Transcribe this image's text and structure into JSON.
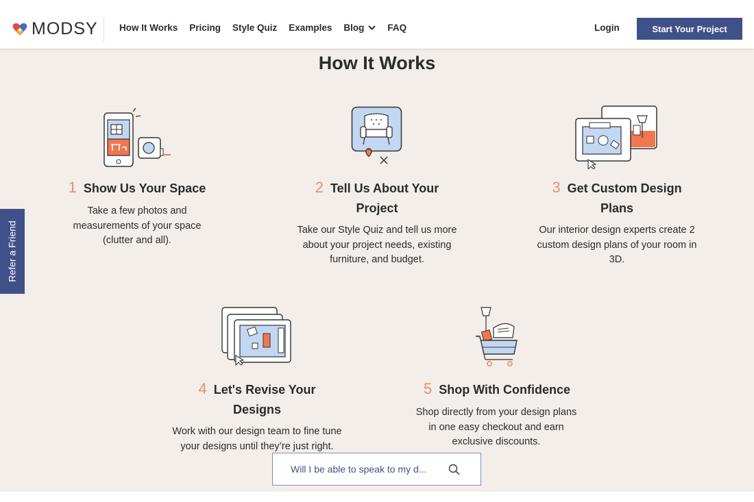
{
  "header": {
    "logo_text": "MODSY",
    "nav": [
      {
        "label": "How It Works"
      },
      {
        "label": "Pricing"
      },
      {
        "label": "Style Quiz"
      },
      {
        "label": "Examples"
      },
      {
        "label": "Blog"
      },
      {
        "label": "FAQ"
      }
    ],
    "login_label": "Login",
    "cta_label": "Start Your Project"
  },
  "main": {
    "title": "How It Works",
    "steps": [
      {
        "number": "1",
        "heading": "Show Us Your Space",
        "description": "Take a few photos and measurements of your space (clutter and all).",
        "icon": "phone-tape-measure-icon"
      },
      {
        "number": "2",
        "heading": "Tell Us About Your Project",
        "description": "Take our Style Quiz and tell us more about your project needs, existing furniture, and budget.",
        "icon": "armchair-quiz-icon"
      },
      {
        "number": "3",
        "heading": "Get Custom Design Plans",
        "description": "Our interior design experts create 2 custom design plans of your room in 3D.",
        "icon": "design-plans-icon"
      },
      {
        "number": "4",
        "heading": "Let's Revise Your Designs",
        "description": "Work with our design team to fine tune your designs until they’re just right.",
        "icon": "revise-designs-icon"
      },
      {
        "number": "5",
        "heading": "Shop With Confidence",
        "description": "Shop directly from your design plans in one easy checkout and earn exclusive discounts.",
        "icon": "shopping-cart-icon"
      }
    ]
  },
  "refer_tab": "Refer a Friend",
  "search": {
    "value": "Will I be able to speak to my d..."
  },
  "colors": {
    "accent": "#405189",
    "highlight": "#f08a6c",
    "background": "#f3eee9",
    "icon_blue": "#c3d7f2"
  }
}
